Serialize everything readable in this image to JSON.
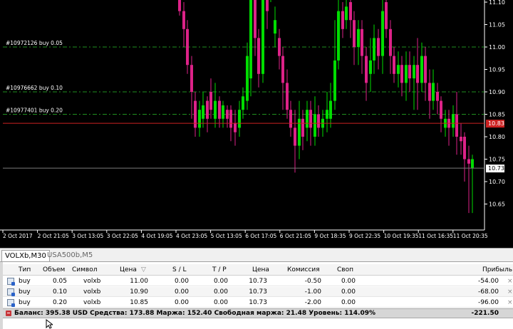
{
  "chart": {
    "background": "#000000",
    "bull_color": "#00dd00",
    "bear_color": "#dd2288",
    "price_levels": [
      "11.10",
      "11.05",
      "11.00",
      "10.95",
      "10.90",
      "10.85",
      "10.80",
      "10.75",
      "10.70",
      "10.65"
    ],
    "current_price_label": "10.73",
    "order_price_label": "10.83",
    "order_lines": [
      {
        "label": "#10972126 buy 0.05"
      },
      {
        "label": "#10976662 buy 0.10"
      },
      {
        "label": "#10977401 buy 0.20"
      }
    ],
    "time_labels": [
      "2 Oct 2017",
      "2 Oct 21:05",
      "3 Oct 13:05",
      "3 Oct 22:05",
      "4 Oct 19:05",
      "4 Oct 23:05",
      "5 Oct 13:05",
      "6 Oct 17:05",
      "6 Oct 21:05",
      "9 Oct 18:35",
      "9 Oct 22:35",
      "10 Oct 19:35",
      "11 Oct 16:35",
      "11 Oct 20:35"
    ]
  },
  "tabs": [
    {
      "label": "VOLXb,M30",
      "active": true
    },
    {
      "label": "USA500b,M5",
      "active": false
    }
  ],
  "table": {
    "headers": {
      "type": "Тип",
      "volume": "Объем",
      "symbol": "Символ",
      "price": "Цена",
      "sl": "S / L",
      "tp": "T / P",
      "cur_price": "Цена",
      "commission": "Комиссия",
      "swap": "Своп",
      "profit": "Прибыль"
    },
    "sort_indicator": "▽",
    "rows": [
      {
        "type": "buy",
        "volume": "0.05",
        "symbol": "volxb",
        "price": "11.00",
        "sl": "0.00",
        "tp": "0.00",
        "cur_price": "10.73",
        "commission": "-0.50",
        "swap": "0.00",
        "profit": "-54.00"
      },
      {
        "type": "buy",
        "volume": "0.10",
        "symbol": "volxb",
        "price": "10.90",
        "sl": "0.00",
        "tp": "0.00",
        "cur_price": "10.73",
        "commission": "-1.00",
        "swap": "0.00",
        "profit": "-68.00"
      },
      {
        "type": "buy",
        "volume": "0.20",
        "symbol": "volxb",
        "price": "10.85",
        "sl": "0.00",
        "tp": "0.00",
        "cur_price": "10.73",
        "commission": "-2.00",
        "swap": "0.00",
        "profit": "-96.00"
      }
    ],
    "close_glyph": "×"
  },
  "summary": {
    "text": "Баланс: 395.38 USD  Средства: 173.88  Маржа: 152.40  Свободная маржа: 21.48  Уровень: 114.09%",
    "profit": "-221.50"
  }
}
